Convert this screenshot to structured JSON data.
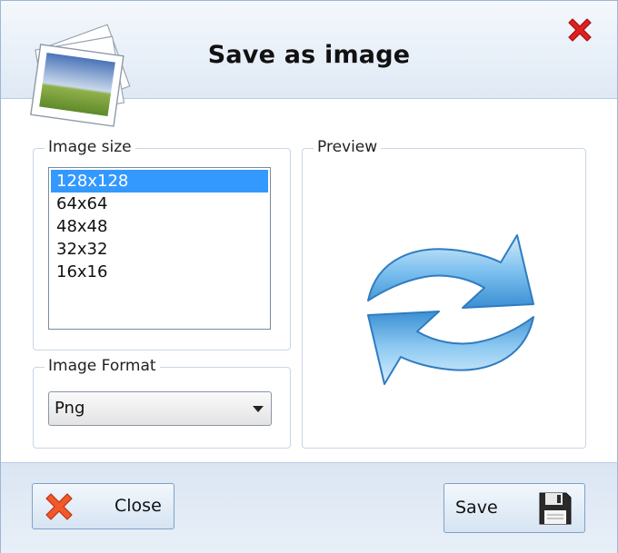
{
  "dialog": {
    "title": "Save as image",
    "close_icon": "close-x-icon",
    "header_icon": "photo-stack-icon"
  },
  "image_size": {
    "label": "Image size",
    "selected": "128x128",
    "items": [
      "128x128",
      "64x64",
      "48x48",
      "32x32",
      "16x16"
    ]
  },
  "image_format": {
    "label": "Image Format",
    "value": "Png"
  },
  "preview": {
    "label": "Preview",
    "icon": "refresh-arrows-icon"
  },
  "footer": {
    "close_label": "Close",
    "close_icon": "red-x-icon",
    "save_label": "Save",
    "save_icon": "floppy-disk-icon"
  },
  "colors": {
    "selection": "#3399ff",
    "header_bg": "#dfe9f5",
    "close_red": "#e02020",
    "arrow_blue": "#4aa3e0"
  }
}
